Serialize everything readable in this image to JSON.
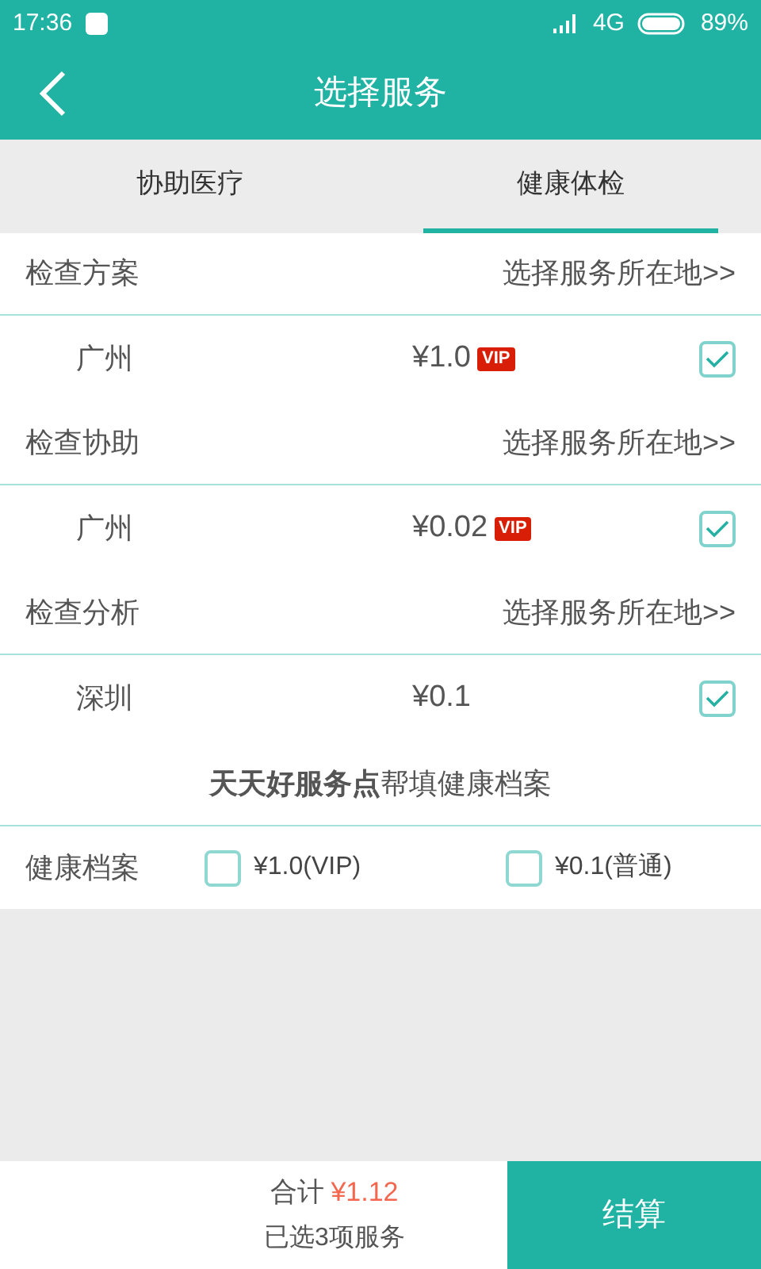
{
  "status_bar": {
    "time": "17:36",
    "network": "4G",
    "battery": "89%"
  },
  "header": {
    "title": "选择服务"
  },
  "tabs": [
    {
      "label": "协助医疗",
      "selected": false
    },
    {
      "label": "健康体检",
      "selected": true
    }
  ],
  "sections": [
    {
      "title": "检查方案",
      "link": "选择服务所在地>>",
      "item": {
        "city": "广州",
        "price": "¥1.0",
        "badge": "VIP",
        "checked": true
      }
    },
    {
      "title": "检查协助",
      "link": "选择服务所在地>>",
      "item": {
        "city": "广州",
        "price": "¥0.02",
        "badge": "VIP",
        "checked": true
      }
    },
    {
      "title": "检查分析",
      "link": "选择服务所在地>>",
      "item": {
        "city": "深圳",
        "price": "¥0.1",
        "checked": true
      }
    }
  ],
  "notice": "**天天好服务点**帮填健康档案",
  "health_record": {
    "label": "健康档案",
    "options": [
      {
        "label": "¥1.0(VIP)",
        "checked": false
      },
      {
        "label": "¥0.1(普通)",
        "checked": false
      }
    ]
  },
  "footer": {
    "total_label": "合计",
    "total": "¥1.12",
    "count": "已选3项服务",
    "button": "结算"
  }
}
